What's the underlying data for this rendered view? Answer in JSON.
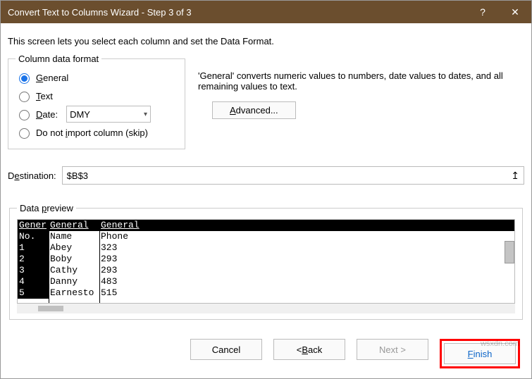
{
  "titlebar": {
    "title": "Convert Text to Columns Wizard - Step 3 of 3",
    "help": "?",
    "close": "✕"
  },
  "lead": "This screen lets you select each column and set the Data Format.",
  "format_legend": "Column data format",
  "radios": {
    "general": "General",
    "text": "Text",
    "date": "Date:",
    "skip": "Do not import column (skip)"
  },
  "date_value": "DMY",
  "right_desc": "'General' converts numeric values to numbers, date values to dates, and all remaining values to text.",
  "advanced_label": "Advanced...",
  "dest_label": "Destination:",
  "dest_value": "$B$3",
  "preview_legend": "Data preview",
  "preview": {
    "headers": [
      "Gener",
      "General",
      "General"
    ],
    "rows": [
      [
        "No.",
        "Name",
        "Phone"
      ],
      [
        "1",
        "Abey",
        "323"
      ],
      [
        "2",
        "Boby",
        "293"
      ],
      [
        "3",
        "Cathy",
        "293"
      ],
      [
        "4",
        "Danny",
        "483"
      ],
      [
        "5",
        "Earnesto",
        "515"
      ]
    ]
  },
  "buttons": {
    "cancel": "Cancel",
    "back": "< Back",
    "next": "Next >",
    "finish": "Finish"
  },
  "watermark": "wsxdn.com"
}
